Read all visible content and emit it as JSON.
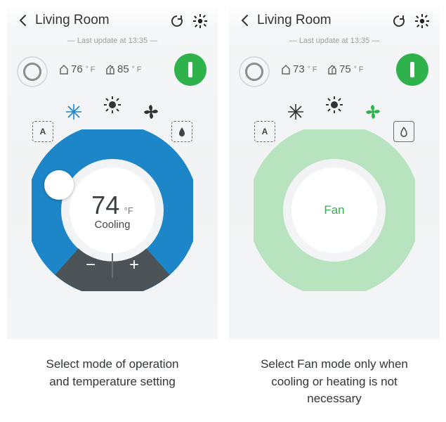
{
  "left": {
    "header": {
      "title": "Living Room"
    },
    "subtitle": "— Last update at 13:35 —",
    "indoor": {
      "value": "76",
      "deg": "°",
      "unit": "F"
    },
    "outdoor": {
      "value": "85",
      "deg": "°",
      "unit": "F"
    },
    "dial": {
      "temp": "74",
      "deg": "°",
      "unit": "F",
      "mode": "Cooling"
    },
    "caption_l1": "Select mode of operation",
    "caption_l2": "and temperature setting",
    "colors": {
      "ring": "#1d86c8",
      "accent": "#2fb24c"
    }
  },
  "right": {
    "header": {
      "title": "Living Room"
    },
    "subtitle": "— Last update at 13:35 —",
    "indoor": {
      "value": "73",
      "deg": "°",
      "unit": "F"
    },
    "outdoor": {
      "value": "75",
      "deg": "°",
      "unit": "F"
    },
    "dial": {
      "mode": "Fan"
    },
    "caption_l1": "Select Fan mode only when",
    "caption_l2": "cooling or heating is not",
    "caption_l3": "necessary",
    "colors": {
      "ring": "#b8e3bf",
      "accent": "#2fb24c"
    }
  }
}
